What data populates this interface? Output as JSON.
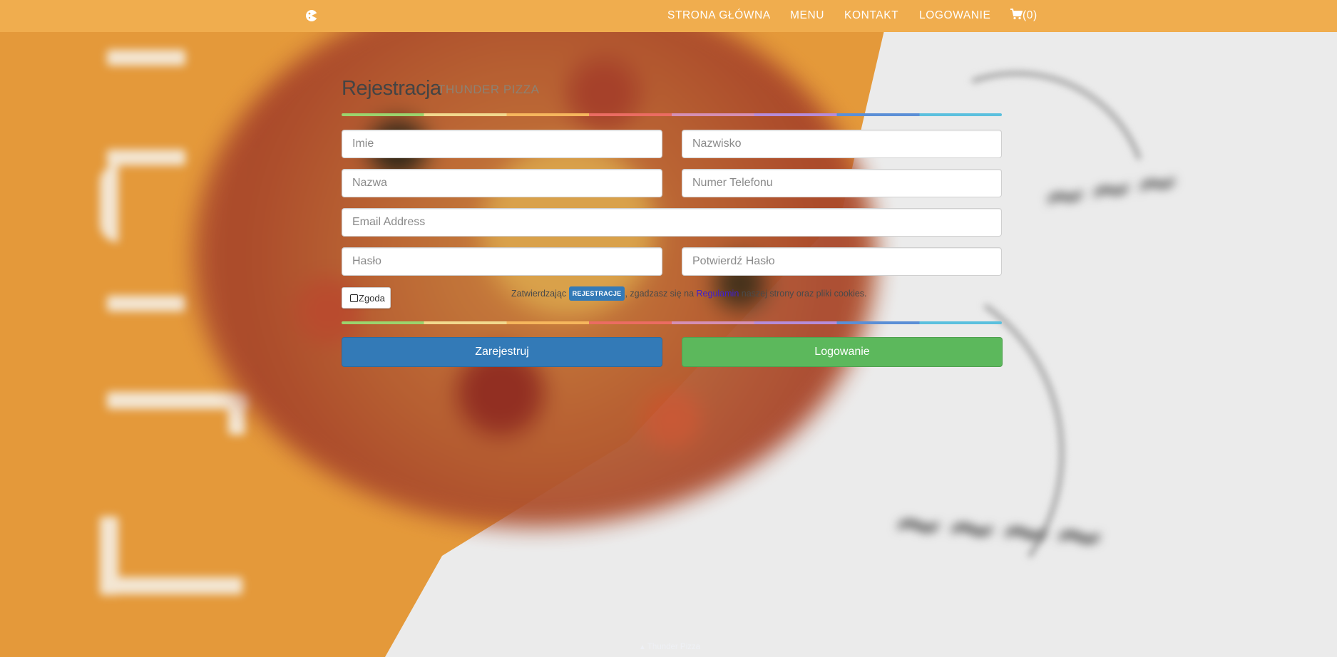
{
  "navbar": {
    "brand_icon": "pizza-logo-icon",
    "items": [
      {
        "label": "STRONA GŁÓWNA"
      },
      {
        "label": "MENU"
      },
      {
        "label": "KONTAKT"
      },
      {
        "label": "LOGOWANIE"
      }
    ],
    "cart_icon": "cart-icon",
    "cart_count": "(0)"
  },
  "form": {
    "title": "Rejestracja",
    "subtitle": "THUNDER PIZZA",
    "fields": {
      "first_name": {
        "placeholder": "Imie",
        "value": ""
      },
      "last_name": {
        "placeholder": "Nazwisko",
        "value": ""
      },
      "username": {
        "placeholder": "Nazwa",
        "value": ""
      },
      "phone": {
        "placeholder": "Numer Telefonu",
        "value": ""
      },
      "email": {
        "placeholder": "Email Address",
        "value": ""
      },
      "password": {
        "placeholder": "Hasło",
        "value": ""
      },
      "password_confirm": {
        "placeholder": "Potwierdź Hasło",
        "value": ""
      }
    },
    "consent": {
      "label": "Zgoda",
      "checked": false,
      "text_before": "Zatwierdzając",
      "badge": "REJESTRACJE",
      "text_middle": ", zgadzasz się na",
      "link": "Regulamin",
      "text_after": "naszej strony oraz pliki cookies."
    },
    "buttons": {
      "register": "Zarejestruj",
      "login": "Logowanie"
    }
  },
  "footer": {
    "arrow_icon": "chevron-up-icon",
    "text": "Thunder Pizza"
  },
  "colors": {
    "navbar": "#f0ad4e",
    "primary": "#337ab7",
    "success": "#5cb85c",
    "background_orange": "#e4993a"
  }
}
